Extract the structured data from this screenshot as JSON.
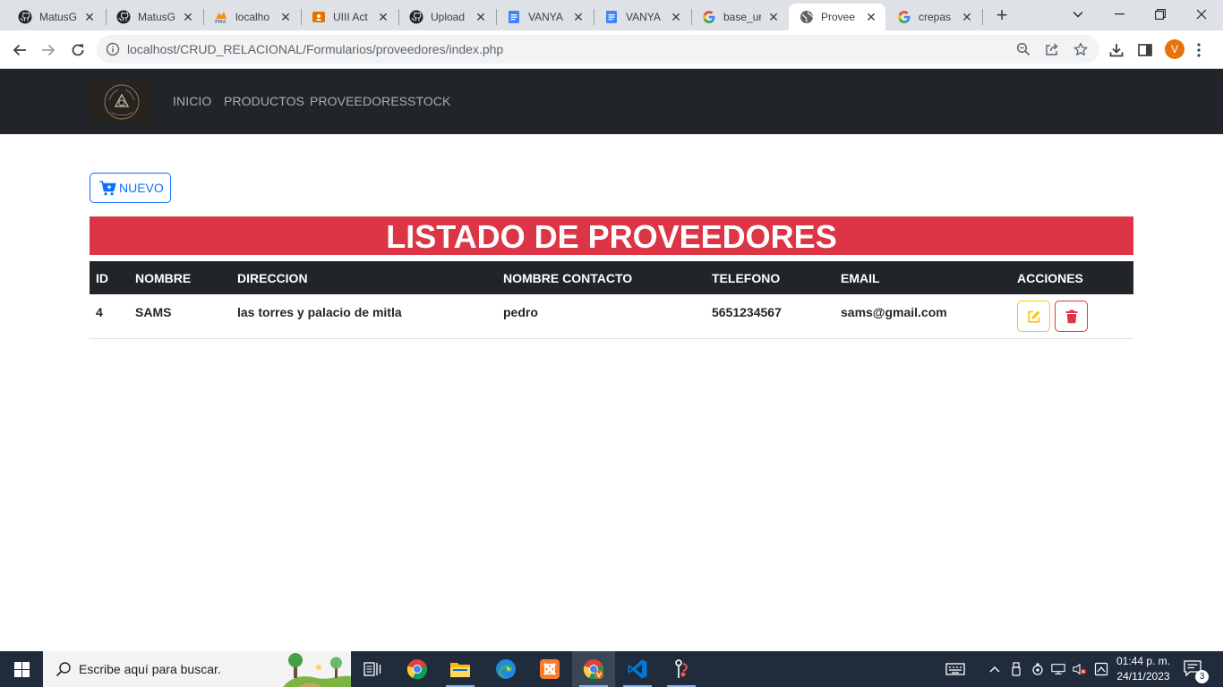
{
  "browser": {
    "tabs": [
      {
        "title": "MatusG",
        "icon": "github-icon"
      },
      {
        "title": "MatusG",
        "icon": "github-icon"
      },
      {
        "title": "localho",
        "icon": "phpmyadmin-icon"
      },
      {
        "title": "UIII Act",
        "icon": "classroom-icon"
      },
      {
        "title": "Upload",
        "icon": "github-icon"
      },
      {
        "title": "VANYA",
        "icon": "docs-icon"
      },
      {
        "title": "VANYA",
        "icon": "docs-icon"
      },
      {
        "title": "base_ur",
        "icon": "google-icon"
      },
      {
        "title": "Provee",
        "icon": "globe-icon",
        "active": true
      },
      {
        "title": "crepas",
        "icon": "google-icon"
      }
    ],
    "url": "localhost/CRUD_RELACIONAL/Formularios/proveedores/index.php",
    "profile_initial": "V"
  },
  "navbar": {
    "items": [
      "INICIO",
      "PRODUCTOS",
      "PROVEEDORES",
      "STOCK"
    ]
  },
  "page": {
    "new_button": "NUEVO",
    "title": "LISTADO DE PROVEEDORES",
    "table": {
      "headers": [
        "ID",
        "NOMBRE",
        "DIRECCION",
        "NOMBRE CONTACTO",
        "TELEFONO",
        "EMAIL",
        "ACCIONES"
      ],
      "rows": [
        [
          "4",
          "SAMS",
          "las torres y palacio de mitla",
          "pedro",
          "5651234567",
          "sams@gmail.com"
        ]
      ]
    }
  },
  "taskbar": {
    "search_placeholder": "Escribe aquí para buscar.",
    "time": "01:44 p. m.",
    "date": "24/11/2023",
    "notification_count": "3"
  },
  "colors": {
    "navbar_bg": "#212529",
    "banner_bg": "#dc3545",
    "primary": "#0d6efd",
    "warning": "#ffc107",
    "danger": "#dc3545"
  }
}
